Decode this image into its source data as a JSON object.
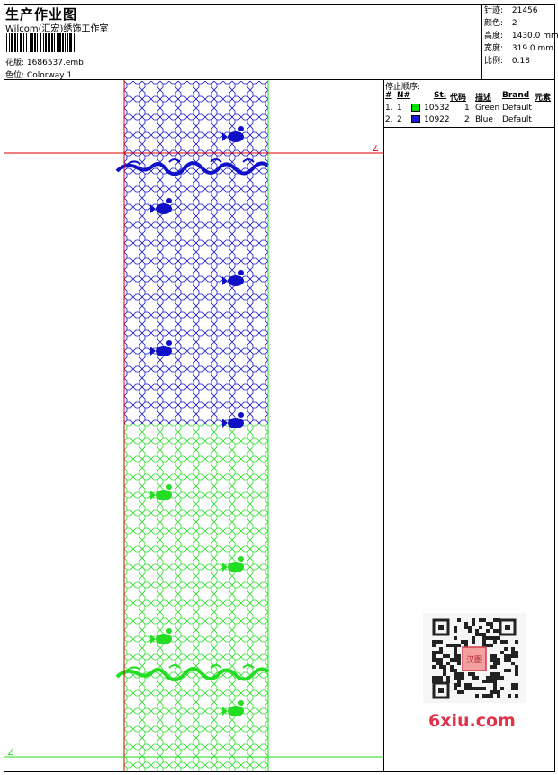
{
  "header": {
    "title": "生产作业图",
    "studio": "Wilcom(汇宏)绣饰工作室",
    "design_label": "花版:",
    "design_value": "1686537.emb",
    "colorway_label": "色位:",
    "colorway_value": "Colorway 1"
  },
  "stats": [
    {
      "label": "针迹:",
      "value": "21456"
    },
    {
      "label": "颜色:",
      "value": "2"
    },
    {
      "label": "高度:",
      "value": "1430.0 mm"
    },
    {
      "label": "宽度:",
      "value": "319.0 mm"
    },
    {
      "label": "比例:",
      "value": "0.18"
    }
  ],
  "stop_sequence": {
    "title": "停止顺序:",
    "columns": [
      "#",
      "N#",
      "St.",
      "代码",
      "描述",
      "Brand",
      "元素"
    ],
    "rows": [
      {
        "index": "1.",
        "n": "1",
        "color": "#00e000",
        "st": "10532",
        "code": "1",
        "desc": "Green",
        "brand": "Default"
      },
      {
        "index": "2.",
        "n": "2",
        "color": "#1a1ad6",
        "st": "10922",
        "code": "2",
        "desc": "Blue",
        "brand": "Default"
      }
    ]
  },
  "design": {
    "blue_color": "#1010c8",
    "green_color": "#22dd22",
    "guide_color": "#e00000",
    "marker_label": "∠"
  },
  "watermark": {
    "logo_text": "6xiu.com",
    "stamp_text": "汉图"
  }
}
